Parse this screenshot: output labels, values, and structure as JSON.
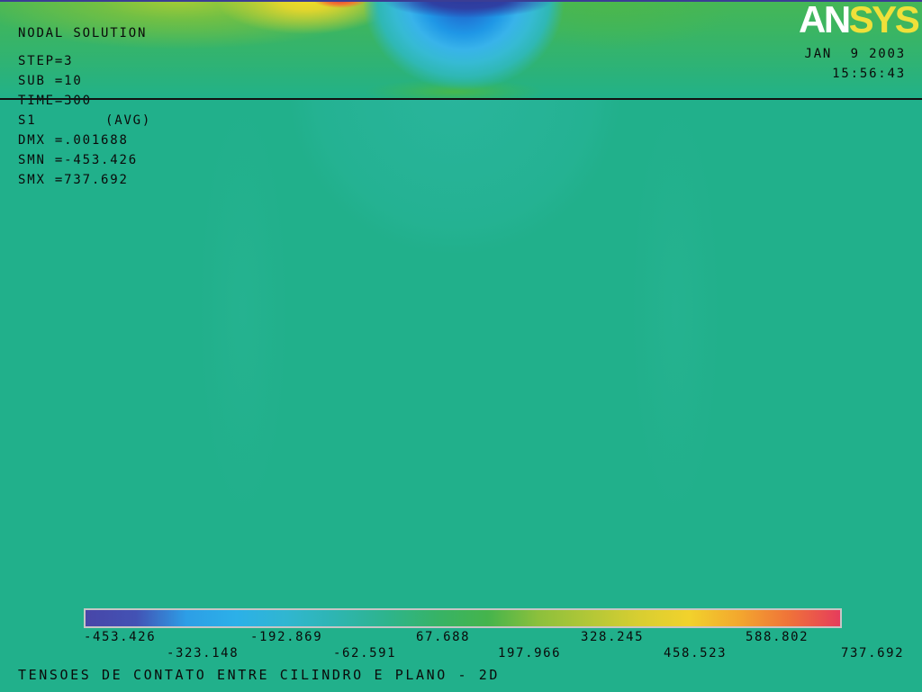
{
  "header": {
    "logo_an": "AN",
    "logo_sys": "SYS",
    "date": "JAN  9 2003",
    "time": "15:56:43"
  },
  "solution_info": {
    "title": "NODAL SOLUTION",
    "step": "STEP=3",
    "sub": "SUB =10",
    "time": "TIME=300",
    "result_item": "S1",
    "averaging": "(AVG)",
    "dmx": "DMX =.001688",
    "smn": "SMN =-453.426",
    "smx": "SMX =737.692"
  },
  "legend": {
    "values": [
      "-453.426",
      "-323.148",
      "-192.869",
      "-62.591",
      "67.688",
      "197.966",
      "328.245",
      "458.523",
      "588.802",
      "737.692"
    ],
    "scale_colors": [
      "#4846a8",
      "#4352b4",
      "#2d9ee6",
      "#2cb0e8",
      "#30b6d0",
      "#2eb5b0",
      "#2eb48c",
      "#37b366",
      "#45b44c",
      "#8cc03c",
      "#b2c737",
      "#d8ce31",
      "#f2d22c",
      "#f3a72e",
      "#ef7239",
      "#e63c5c"
    ]
  },
  "plot_title": "TENSOES DE CONTATO ENTRE CILINDRO E PLANO - 2D",
  "colors": {
    "background": "#21b08b",
    "text": "#0a0a0a",
    "model_edge_line": "#111111",
    "top_strip": "#3b3d94",
    "logo_an": "#ffffff",
    "logo_sys": "#efe03a",
    "legend_frame": "#c6c6c6"
  }
}
